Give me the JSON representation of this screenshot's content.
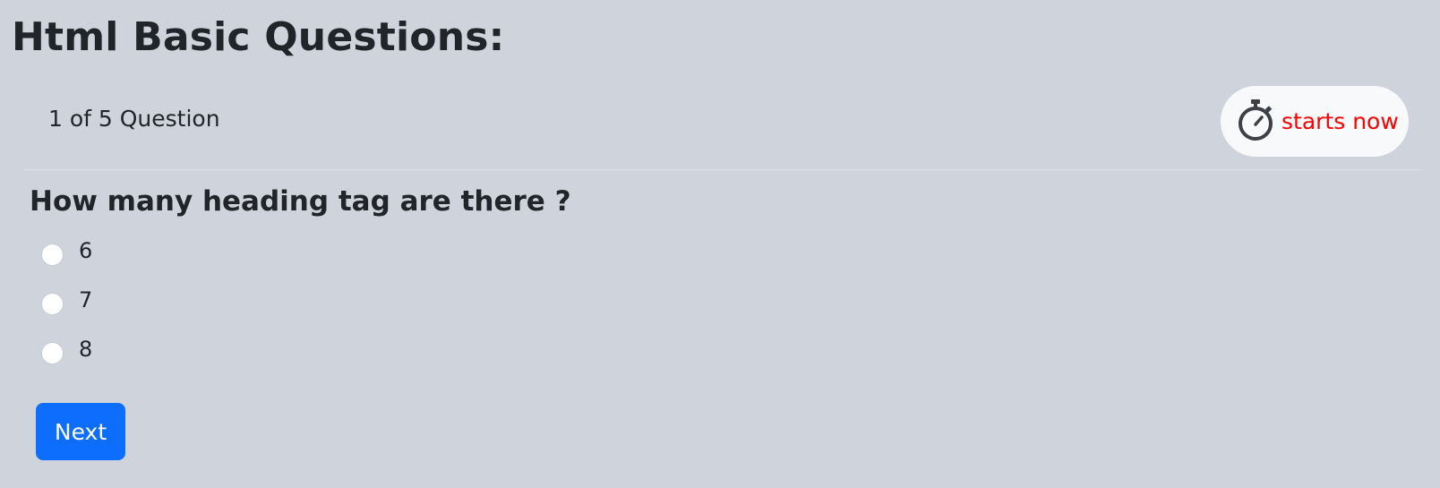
{
  "page": {
    "title": "Html Basic Questions:"
  },
  "header": {
    "counter": "1 of 5 Question",
    "timer": {
      "icon": "stopwatch-icon",
      "text": "starts now",
      "text_color": "#ff0000"
    }
  },
  "question": {
    "text": "How many heading tag are there ?",
    "options": [
      {
        "label": "6",
        "selected": false
      },
      {
        "label": "7",
        "selected": false
      },
      {
        "label": "8",
        "selected": false
      }
    ]
  },
  "actions": {
    "next_label": "Next"
  },
  "colors": {
    "background": "#cfd4dc",
    "primary": "#0d6efd",
    "pill_background": "#f8f9fa"
  }
}
